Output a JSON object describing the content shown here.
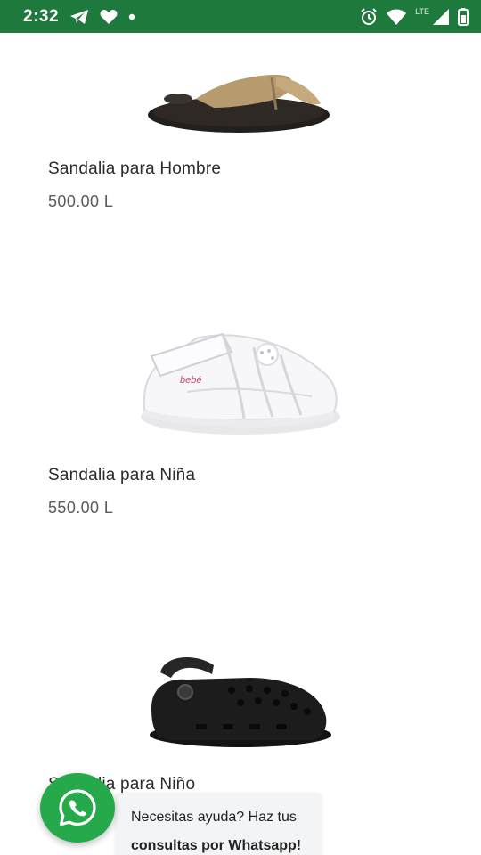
{
  "status_bar": {
    "time": "2:32",
    "network_label": "LTE",
    "icons": [
      "telegram-icon",
      "heart-icon",
      "notification-dot-icon",
      "alarm-icon",
      "wifi-icon",
      "signal-icon",
      "battery-icon"
    ]
  },
  "products": [
    {
      "name": "Sandalia para Hombre",
      "price": "500.00 L",
      "image": "flip-flop-sandal"
    },
    {
      "name": "Sandalia para Niña",
      "price": "550.00 L",
      "image": "white-girls-sandal"
    },
    {
      "name": "Sandalia para Niño",
      "price": "",
      "image": "black-clog"
    }
  ],
  "whatsapp": {
    "line1": "Necesitas ayuda? Haz tus",
    "line2": "consultas por Whatsapp!"
  },
  "colors": {
    "status_bar": "#1e7a3c",
    "whatsapp_green": "#25a94a"
  }
}
